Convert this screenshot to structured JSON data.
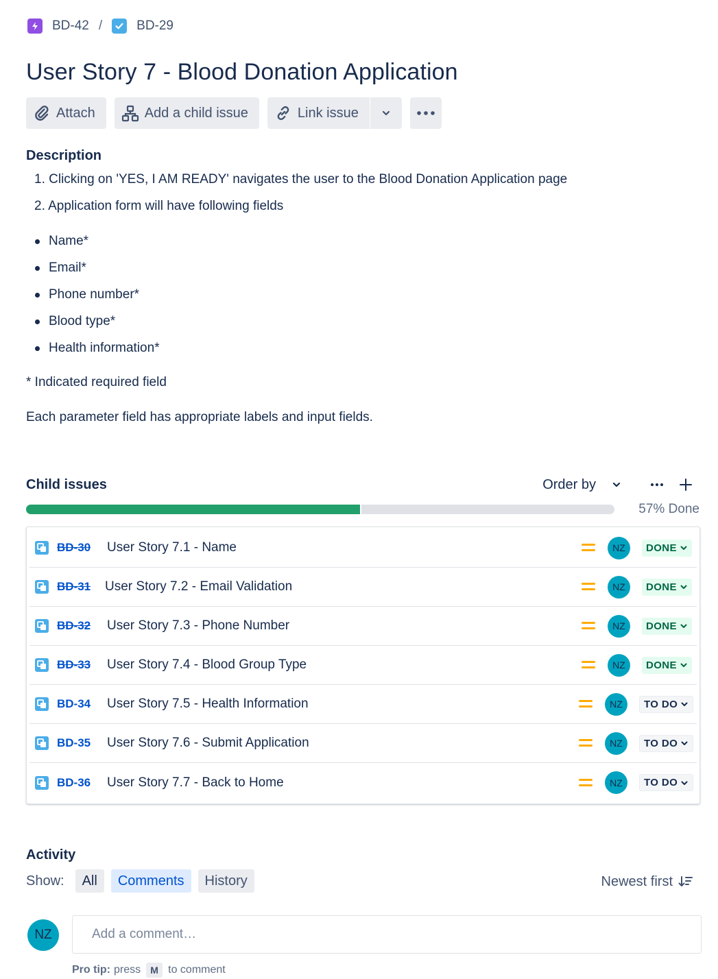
{
  "breadcrumb": {
    "parent_key": "BD-42",
    "separator": "/",
    "current_key": "BD-29"
  },
  "title": "User Story 7 - Blood Donation Application",
  "toolbar": {
    "attach": "Attach",
    "add_child": "Add a child issue",
    "link_issue": "Link issue"
  },
  "description": {
    "heading": "Description",
    "ordered": [
      "Clicking on 'YES, I AM READY' navigates the user to the Blood Donation Application page",
      "Application form will have following fields"
    ],
    "fields": [
      "Name*",
      "Email*",
      "Phone number*",
      "Blood type*",
      "Health information*"
    ],
    "note": "* Indicated required field",
    "para": "Each parameter field has appropriate labels and input fields."
  },
  "child_issues": {
    "heading": "Child issues",
    "order_by": "Order by",
    "progress_percent": 57,
    "progress_label": "57% Done",
    "items": [
      {
        "key": "BD-30",
        "summary": "User Story 7.1 - Name",
        "assignee": "NZ",
        "status": "DONE",
        "done": true,
        "priority": "medium"
      },
      {
        "key": "BD-31",
        "summary": "User Story 7.2 - Email Validation",
        "assignee": "NZ",
        "status": "DONE",
        "done": true,
        "priority": "medium"
      },
      {
        "key": "BD-32",
        "summary": "User Story 7.3 - Phone Number",
        "assignee": "NZ",
        "status": "DONE",
        "done": true,
        "priority": "medium"
      },
      {
        "key": "BD-33",
        "summary": "User Story 7.4 - Blood Group Type",
        "assignee": "NZ",
        "status": "DONE",
        "done": true,
        "priority": "medium"
      },
      {
        "key": "BD-34",
        "summary": "User Story 7.5 - Health Information",
        "assignee": "NZ",
        "status": "TO DO",
        "done": false,
        "priority": "medium"
      },
      {
        "key": "BD-35",
        "summary": "User Story 7.6 - Submit Application",
        "assignee": "NZ",
        "status": "TO DO",
        "done": false,
        "priority": "medium"
      },
      {
        "key": "BD-36",
        "summary": "User Story 7.7 - Back to Home",
        "assignee": "NZ",
        "status": "TO DO",
        "done": false,
        "priority": "medium"
      }
    ]
  },
  "activity": {
    "heading": "Activity",
    "show_label": "Show:",
    "filters": [
      "All",
      "Comments",
      "History"
    ],
    "active_filter": "Comments",
    "sort": "Newest first",
    "user_initials": "NZ",
    "comment_placeholder": "Add a comment…",
    "pro_tip_label": "Pro tip:",
    "pro_tip_press": "press",
    "pro_tip_key": "M",
    "pro_tip_suffix": "to comment"
  },
  "colors": {
    "accent": "#0052cc",
    "progress": "#22a06b",
    "done_bg": "#e3fcef",
    "done_text": "#006644",
    "priority_medium": "#ffab00",
    "avatar": "#00a3bf",
    "epic": "#904ee2",
    "story": "#4bade8"
  }
}
